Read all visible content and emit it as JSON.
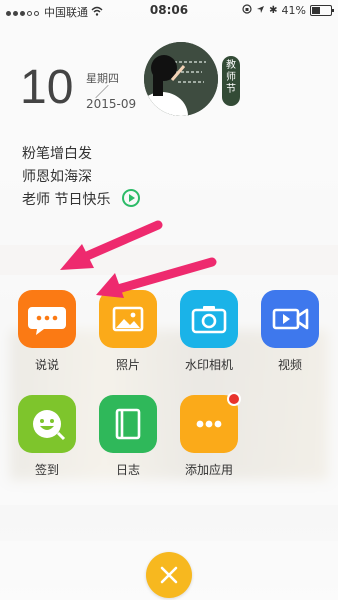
{
  "status_bar": {
    "carrier": "中国联通",
    "time": "08:06",
    "battery": "41%"
  },
  "date": {
    "day": "10",
    "weekday": "星期四",
    "slash": "／",
    "year_month": "2015-09"
  },
  "festival_tag": "教师节",
  "poem": {
    "line1": "粉笔增白发",
    "line2": "师恩如海深",
    "line3": "老师 节日快乐"
  },
  "apps": [
    {
      "label": "说说",
      "icon": "chat-bubble-icon",
      "color": "#fb7a14"
    },
    {
      "label": "照片",
      "icon": "photo-icon",
      "color": "#fbaa19"
    },
    {
      "label": "水印相机",
      "icon": "camera-icon",
      "color": "#1ab3e8"
    },
    {
      "label": "视频",
      "icon": "video-icon",
      "color": "#3e78ed"
    },
    {
      "label": "签到",
      "icon": "checkin-smile-icon",
      "color": "#7ec52c"
    },
    {
      "label": "日志",
      "icon": "notebook-icon",
      "color": "#2fb85a"
    },
    {
      "label": "添加应用",
      "icon": "more-dots-icon",
      "color": "#fbaa19"
    }
  ],
  "colors": {
    "arrow": "#ee2a6e",
    "close_button": "#f7b81f"
  }
}
